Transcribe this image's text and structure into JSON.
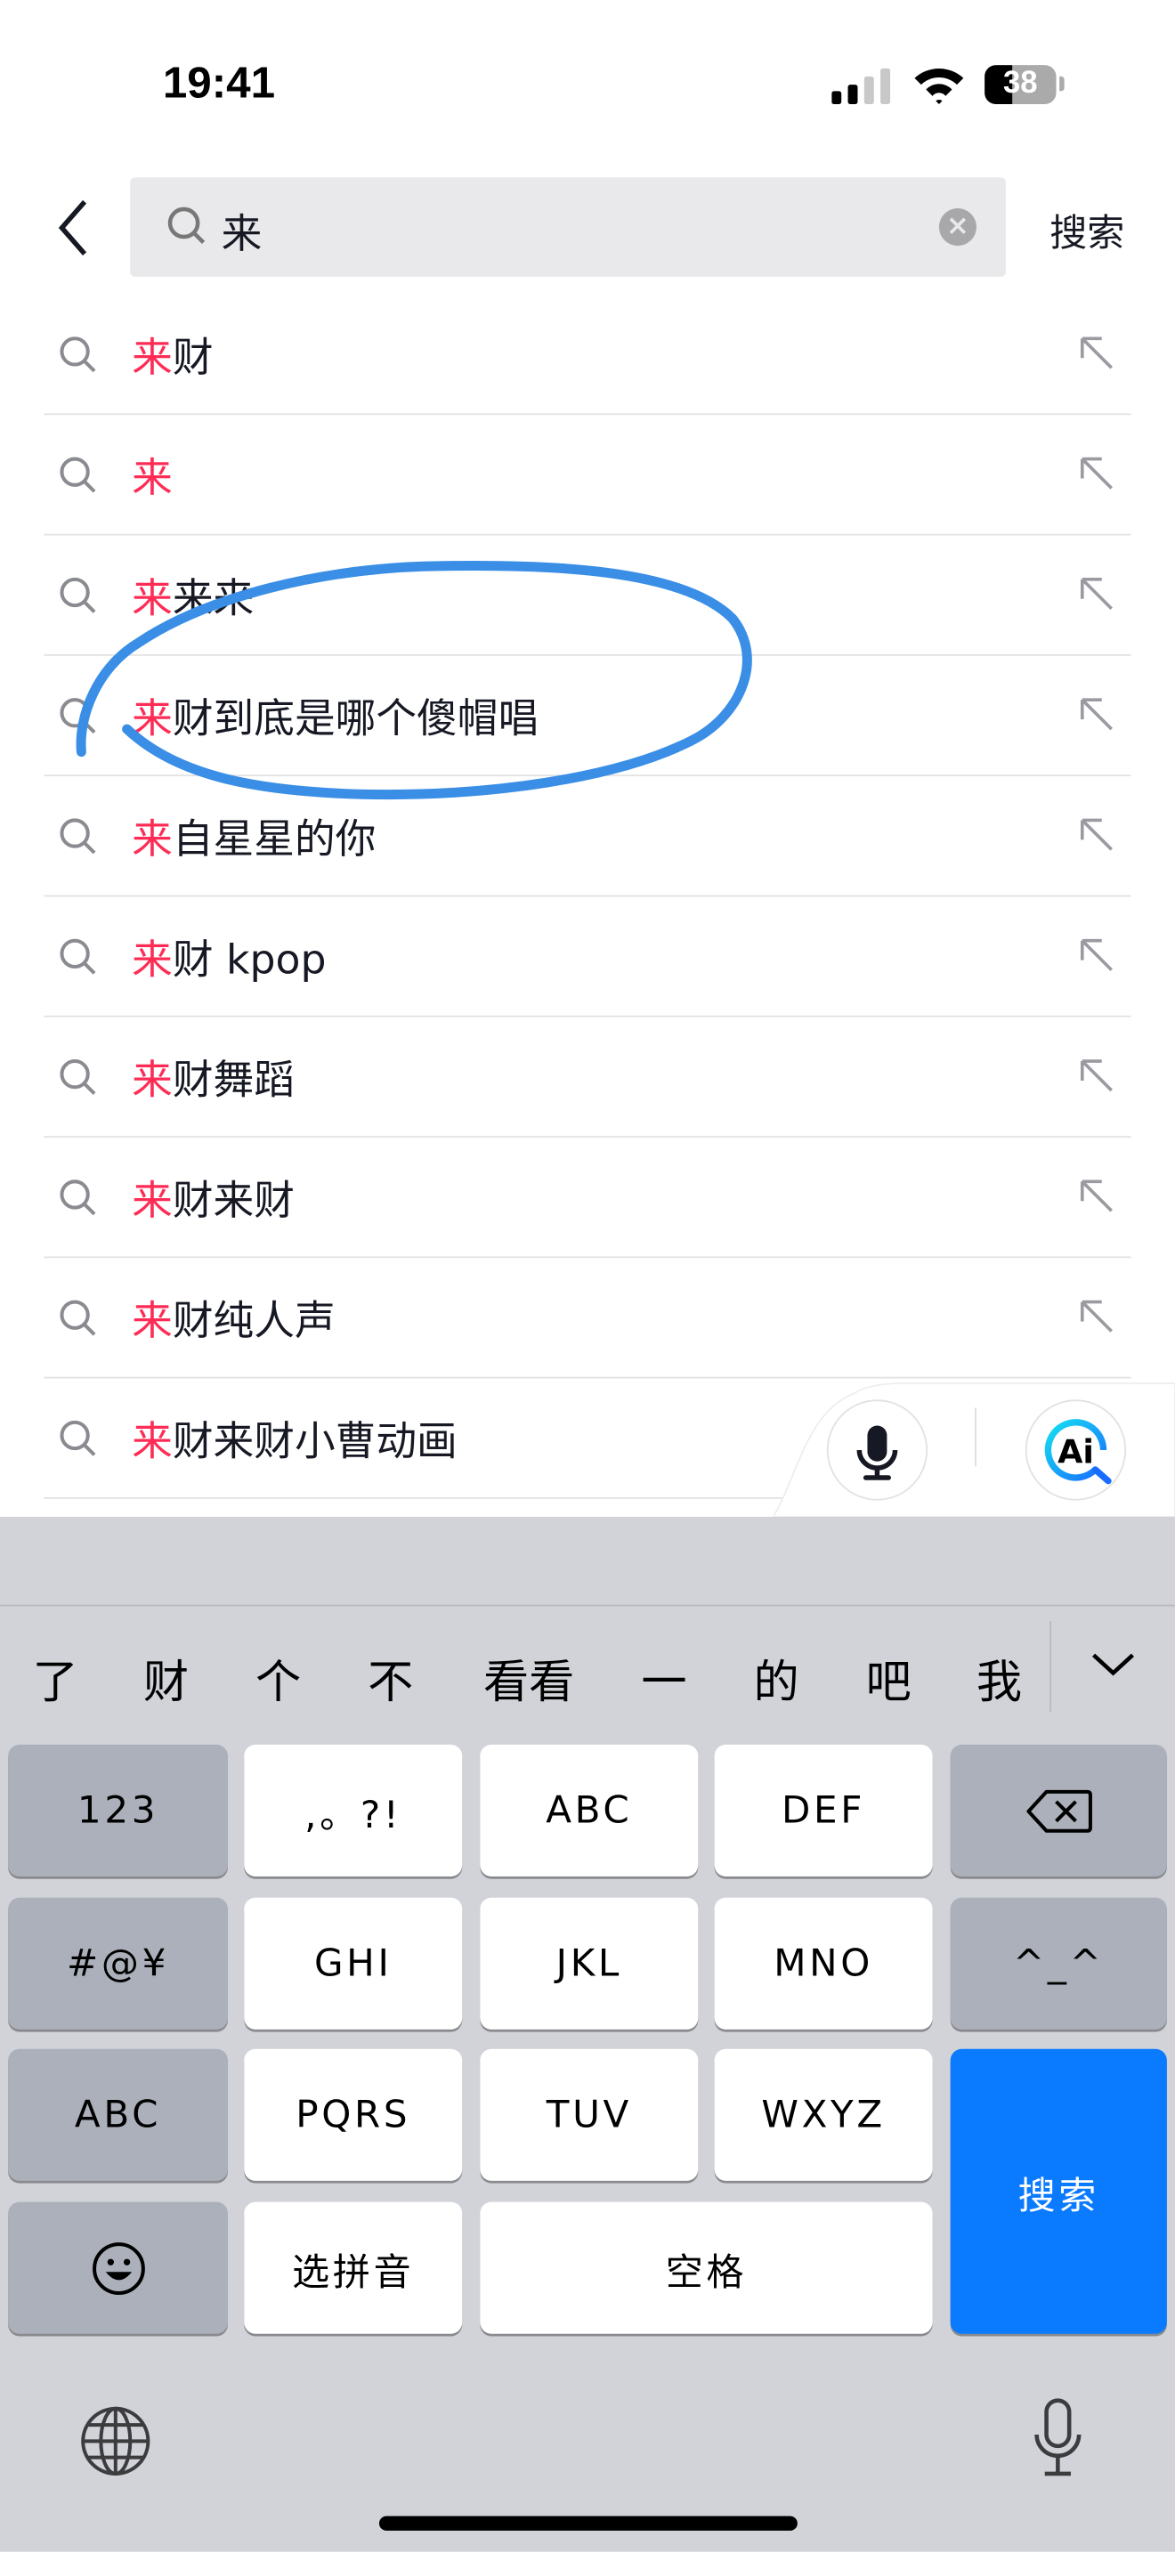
{
  "status_bar": {
    "time": "19:41",
    "battery": "38",
    "battery_level_percent": 38
  },
  "search": {
    "back_icon": "chevron-left-icon",
    "value": "来",
    "clear_icon": "clear-icon",
    "submit_label": "搜索"
  },
  "suggestions": [
    {
      "highlight": "来",
      "rest": "财"
    },
    {
      "highlight": "来",
      "rest": ""
    },
    {
      "highlight": "来",
      "rest": "来来"
    },
    {
      "highlight": "来",
      "rest": "财到底是哪个傻帽唱"
    },
    {
      "highlight": "来",
      "rest": "自星星的你"
    },
    {
      "highlight": "来",
      "rest": "财 kpop"
    },
    {
      "highlight": "来",
      "rest": "财舞蹈"
    },
    {
      "highlight": "来",
      "rest": "财来财"
    },
    {
      "highlight": "来",
      "rest": "财纯人声"
    },
    {
      "highlight": "来",
      "rest": "财来财小曹动画"
    }
  ],
  "floating_actions": {
    "voice_icon": "microphone-icon",
    "ai_icon": "ai-search-icon",
    "ai_label": "Ai"
  },
  "keyboard": {
    "candidates": [
      "了",
      "财",
      "个",
      "不",
      "看看",
      "一",
      "的",
      "吧",
      "我"
    ],
    "expand_icon": "chevron-down-icon",
    "keys": {
      "num": "123",
      "punct": ",。?!",
      "abc": "ABC",
      "def": "DEF",
      "delete_icon": "backspace-icon",
      "sym": "#@¥",
      "ghi": "GHI",
      "jkl": "JKL",
      "mno": "MNO",
      "emoticon": "^_^",
      "abc_mode": "ABC",
      "pqrs": "PQRS",
      "tuv": "TUV",
      "wxyz": "WXYZ",
      "search": "搜索",
      "emoji_icon": "emoji-icon",
      "pinyin": "选拼音",
      "space": "空格"
    },
    "globe_icon": "globe-icon",
    "dictation_icon": "microphone-icon"
  },
  "colors": {
    "highlight": "#fe2c55",
    "annotation": "#3a8ee6",
    "search_key": "#0a7aff"
  }
}
